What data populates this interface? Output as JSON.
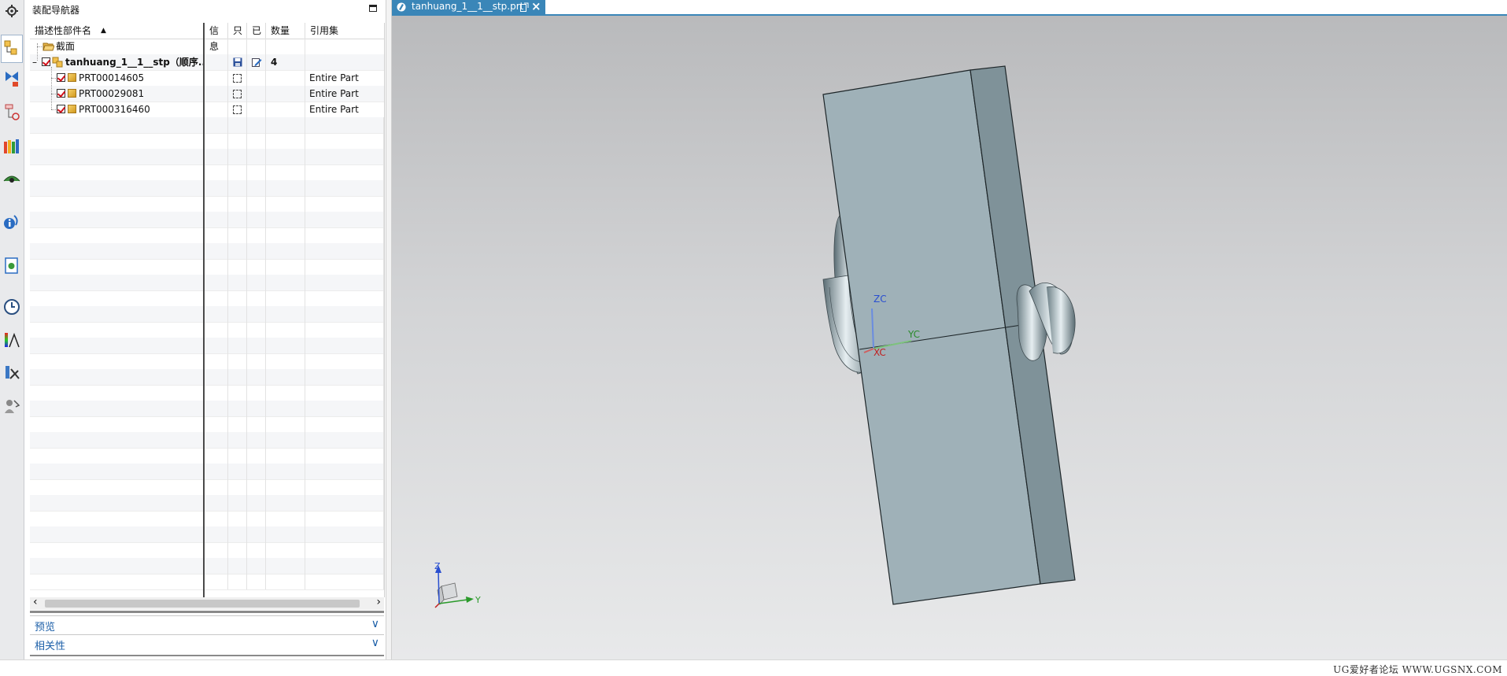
{
  "navigator": {
    "title": "装配导航器",
    "columns": [
      "描述性部件名",
      "信息",
      "只",
      "已",
      "数量",
      "引用集"
    ],
    "sort_indicator": "▲",
    "rows": [
      {
        "name": "截面",
        "qty": "",
        "refset": ""
      },
      {
        "name": "tanhuang_1__1__stp（顺序...",
        "qty": "4",
        "refset": ""
      },
      {
        "name": "PRT00014605",
        "qty": "",
        "refset": "Entire Part"
      },
      {
        "name": "PRT00029081",
        "qty": "",
        "refset": "Entire Part"
      },
      {
        "name": "PRT000316460",
        "qty": "",
        "refset": "Entire Part"
      }
    ],
    "tree_toggle": "–",
    "scroll_left": "‹",
    "scroll_right": "›"
  },
  "sections": [
    {
      "label": "预览",
      "chevron": "∨"
    },
    {
      "label": "相关性",
      "chevron": "∨"
    }
  ],
  "tab": {
    "label": "tanhuang_1__1__stp.prt",
    "close": "×"
  },
  "viewport": {
    "wcs_labels": {
      "z": "ZC",
      "y": "YC",
      "x": "XC"
    },
    "triad_labels": {
      "z": "Z",
      "y": "Y"
    }
  },
  "status": {
    "watermark": "UG爱好者论坛 WWW.UGSNX.COM"
  },
  "colors": {
    "accent": "#3a86b8",
    "part": "#9fb1b8",
    "check": "#d0101a"
  },
  "toolbar_icons": [
    "settings-icon",
    "assembly-navigator-icon",
    "constraint-navigator-icon",
    "part-navigator-icon",
    "reuse-library-icon",
    "view-manager-icon",
    "info-icon",
    "web-browser-icon",
    "history-icon",
    "analysis-icon",
    "process-icon",
    "roles-icon"
  ]
}
